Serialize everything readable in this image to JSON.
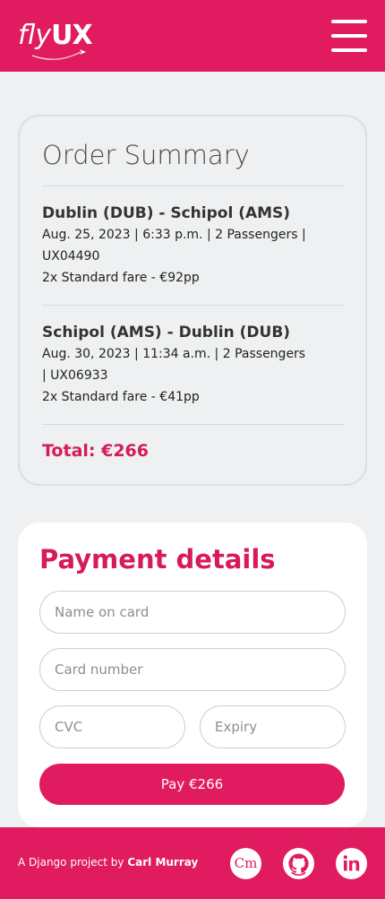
{
  "header": {
    "logo_fly": "fly",
    "logo_ux": "UX",
    "menu_icon": "hamburger-menu-icon"
  },
  "summary": {
    "title": "Order Summary",
    "flights": [
      {
        "route": "Dublin (DUB) - Schipol (AMS)",
        "details": "Aug. 25, 2023 | 6:33 p.m. | 2 Passengers | UX04490",
        "fare": "2x Standard fare - €92pp"
      },
      {
        "route": "Schipol (AMS) - Dublin (DUB)",
        "details": "Aug. 30, 2023 | 11:34 a.m. | 2 Passengers | UX06933",
        "fare": "2x Standard fare - €41pp"
      }
    ],
    "total": "Total: €266"
  },
  "payment": {
    "title": "Payment details",
    "name_placeholder": "Name on card",
    "card_placeholder": "Card number",
    "cvc_placeholder": "CVC",
    "expiry_placeholder": "Expiry",
    "pay_label": "Pay €266"
  },
  "footer": {
    "credit_prefix": "A Django project by ",
    "credit_name": "Carl Murray",
    "cm_label": "Cm",
    "icons": [
      "cm-portfolio-icon",
      "github-icon",
      "linkedin-icon"
    ]
  },
  "colors": {
    "brand": "#e01b5f",
    "accent_text": "#d71a5b",
    "background": "#eef0f1"
  }
}
